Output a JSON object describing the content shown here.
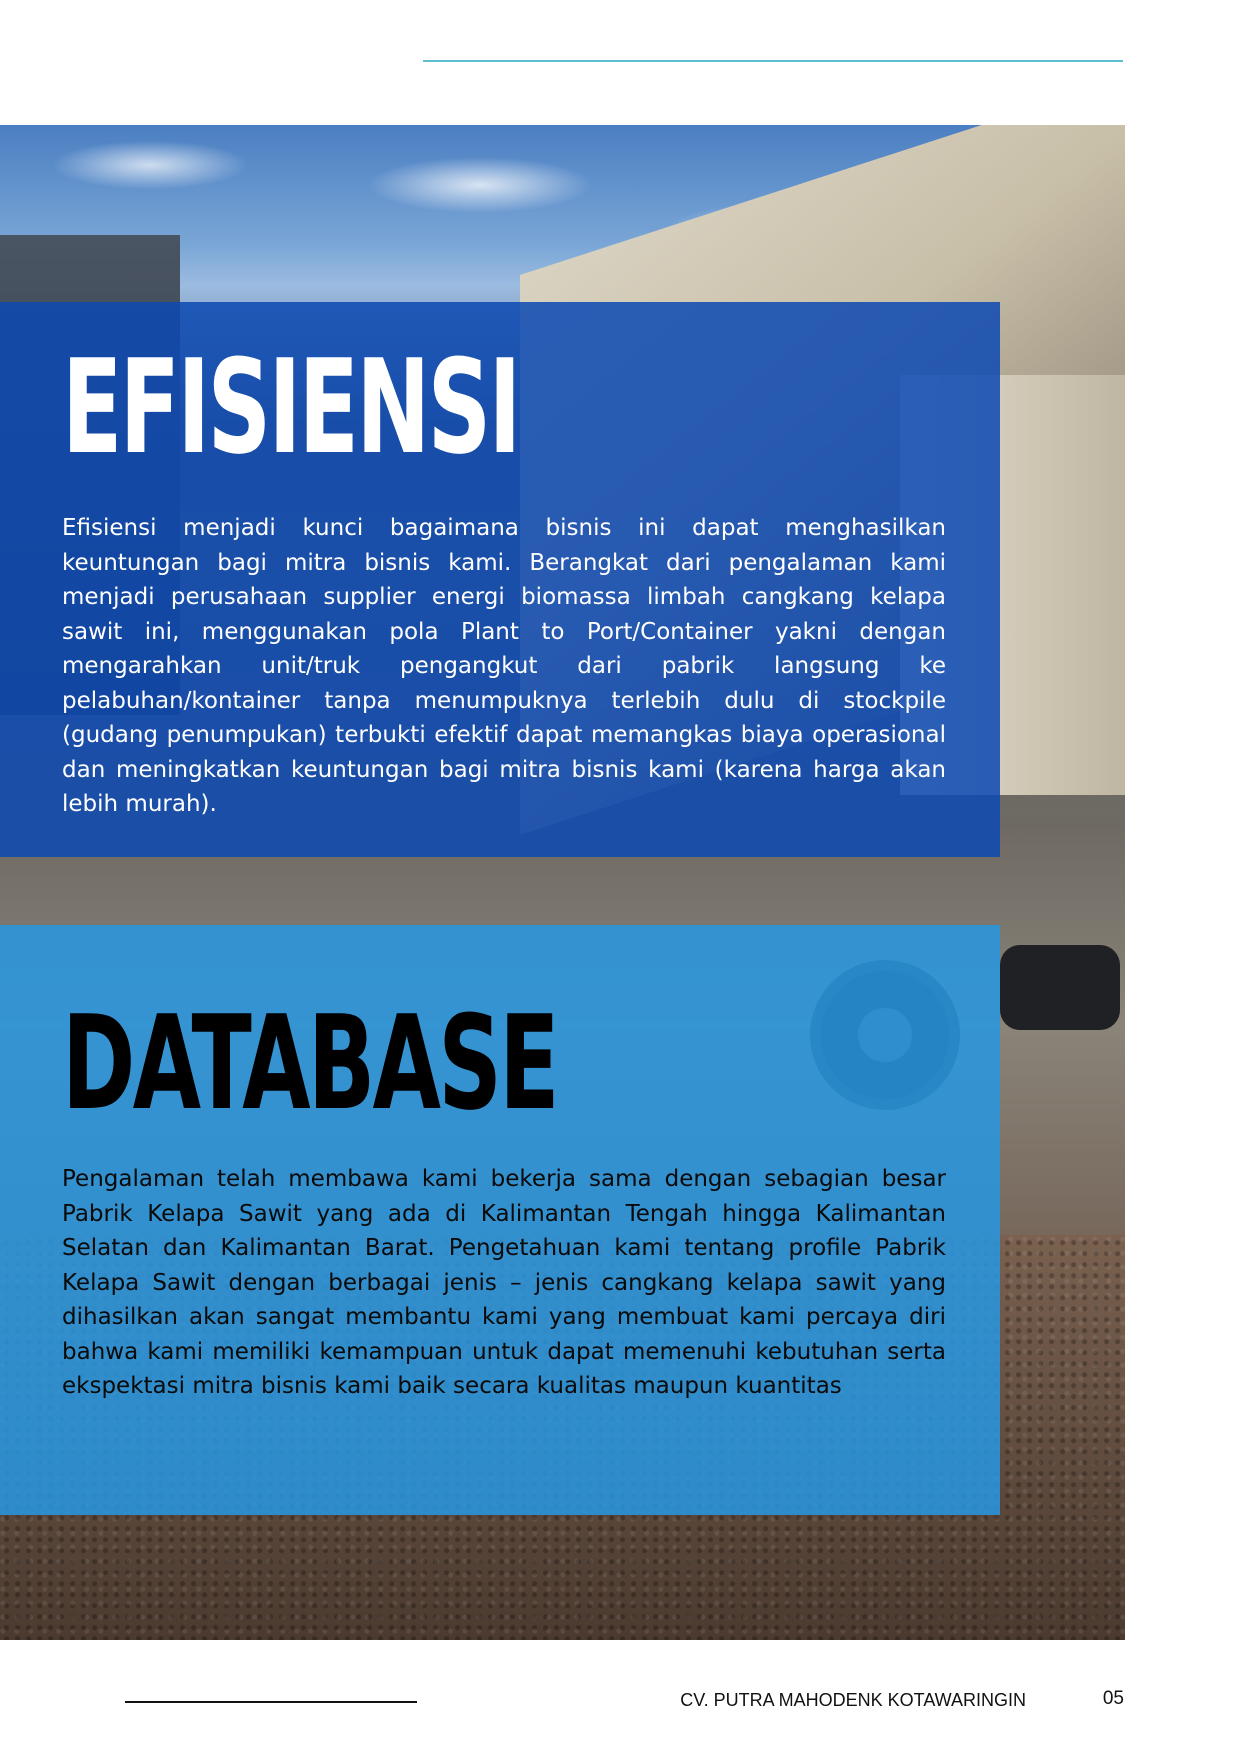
{
  "sections": {
    "efisiensi": {
      "title": "EFISIENSI",
      "body": "Efisiensi menjadi kunci bagaimana bisnis ini dapat menghasilkan keuntungan bagi mitra bisnis kami. Berangkat dari pengalaman kami menjadi perusahaan supplier energi biomassa limbah cangkang kelapa sawit ini, menggunakan pola Plant to Port/Container yakni dengan mengarahkan unit/truk pengangkut dari pabrik langsung ke pelabuhan/kontainer tanpa menumpuknya terlebih dulu di stockpile (gudang penumpukan) terbukti efektif dapat memangkas biaya operasional dan meningkatkan keuntungan bagi mitra bisnis kami (karena harga akan lebih murah)."
    },
    "database": {
      "title": "DATABASE",
      "body": "Pengalaman telah membawa kami bekerja sama dengan sebagian besar Pabrik Kelapa Sawit yang ada di Kalimantan Tengah hingga Kalimantan Selatan dan Kalimantan Barat. Pengetahuan kami tentang profile Pabrik Kelapa Sawit dengan berbagai jenis – jenis cangkang kelapa sawit yang dihasilkan akan sangat membantu kami yang membuat kami percaya diri bahwa kami memiliki kemampuan untuk dapat memenuhi kebutuhan serta ekspektasi mitra bisnis kami baik secara kualitas maupun kuantitas"
    }
  },
  "footer": {
    "company": "CV. PUTRA MAHODENK KOTAWARINGIN",
    "page_number": "05"
  },
  "colors": {
    "accent_rule": "#5bbfcf",
    "efisiensi_panel": "#0d49b2",
    "database_panel": "#2896e1"
  }
}
